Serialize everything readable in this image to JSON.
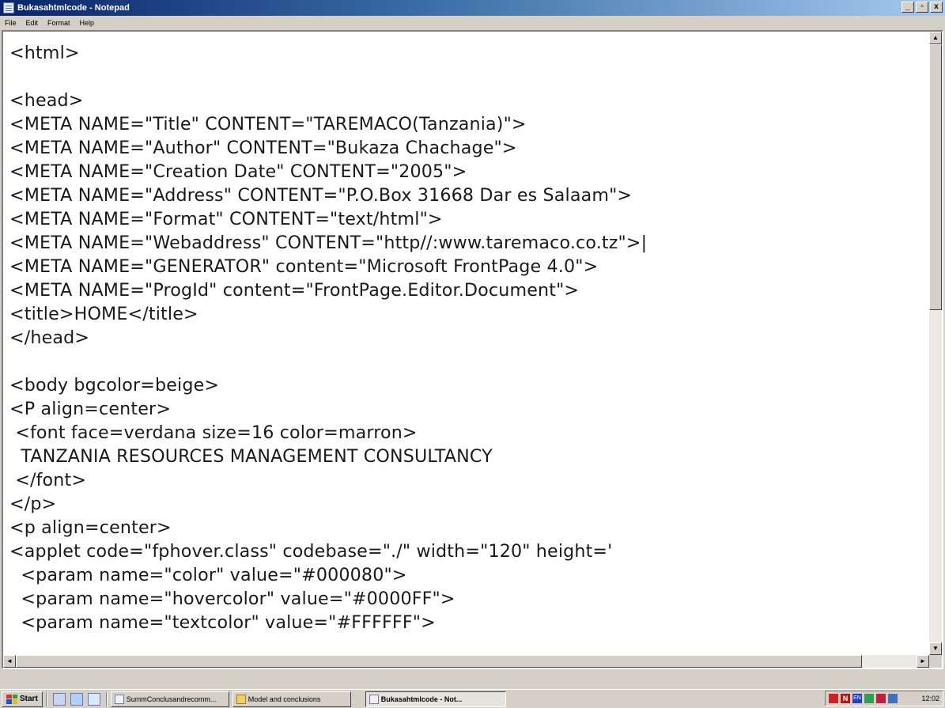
{
  "window": {
    "title": "Bukasahtmlcode - Notepad",
    "buttons": {
      "minimize": "_",
      "maximize": "▫",
      "close": "x"
    }
  },
  "menu": [
    "File",
    "Edit",
    "Format",
    "Help"
  ],
  "editor": {
    "lines": [
      "<html>",
      "",
      "<head>",
      "<META NAME=\"Title\" CONTENT=\"TAREMACO(Tanzania)\">",
      "<META NAME=\"Author\" CONTENT=\"Bukaza Chachage\">",
      "<META NAME=\"Creation Date\" CONTENT=\"2005\">",
      "<META NAME=\"Address\" CONTENT=\"P.O.Box 31668 Dar es Salaam\">",
      "<META NAME=\"Format\" CONTENT=\"text/html\">",
      "<META NAME=\"Webaddress\" CONTENT=\"http//:www.taremaco.co.tz\">|",
      "<META NAME=\"GENERATOR\" content=\"Microsoft FrontPage 4.0\">",
      "<META NAME=\"ProgId\" content=\"FrontPage.Editor.Document\">",
      "<title>HOME</title>",
      "</head>",
      "",
      "<body bgcolor=beige>",
      "<P align=center>",
      " <font face=verdana size=16 color=marron>",
      "  TANZANIA RESOURCES MANAGEMENT CONSULTANCY",
      " </font>",
      "</p>",
      "<p align=center>",
      "<applet code=\"fphover.class\" codebase=\"./\" width=\"120\" height='",
      "  <param name=\"color\" value=\"#000080\">",
      "  <param name=\"hovercolor\" value=\"#0000FF\">",
      "  <param name=\"textcolor\" value=\"#FFFFFF\">"
    ]
  },
  "scrollbars": {
    "up": "▲",
    "down": "▼",
    "left": "◄",
    "right": "►"
  },
  "taskbar": {
    "start_label": "Start",
    "tasks": [
      {
        "label": "SummConclusandrecomm...",
        "icon": "document-icon",
        "active": false
      },
      {
        "label": "Model and conclusions",
        "icon": "folder-icon",
        "active": false
      },
      {
        "label": "Bukasahtmlcode - Not...",
        "icon": "notepad-icon",
        "active": true
      }
    ],
    "tray": {
      "t2": "N",
      "t3": "EN"
    },
    "clock": "12:02"
  },
  "colors": {
    "titlebar_start": "#0a246a",
    "titlebar_end": "#a6caf0",
    "chrome": "#d4d0c8",
    "editor_bg": "#ffffff"
  }
}
